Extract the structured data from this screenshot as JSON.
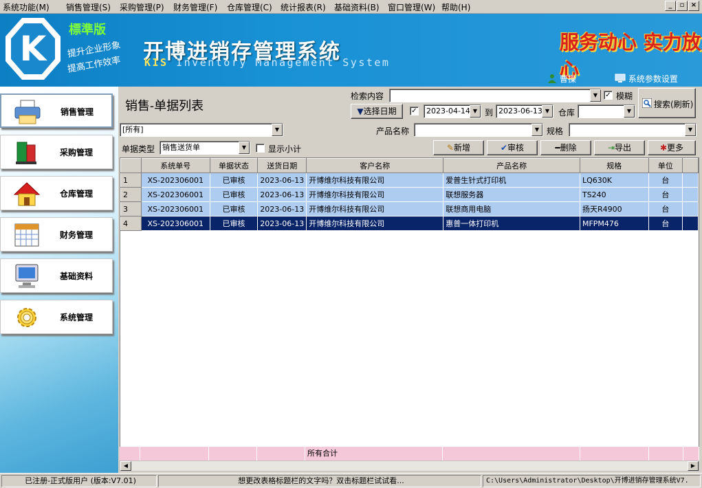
{
  "menu": [
    "系统功能(M)",
    "销售管理(S)",
    "采购管理(P)",
    "财务管理(F)",
    "仓库管理(C)",
    "统计报表(R)",
    "基础资料(B)",
    "窗口管理(W)",
    "帮助(H)"
  ],
  "window_buttons": [
    "_",
    "▫",
    "×"
  ],
  "banner": {
    "logo_letter": "K",
    "edition": "標準版",
    "slogan1": "提升企业形象",
    "slogan2": "提高工作效率",
    "title": "开博进销存管理系统",
    "subtitle_kis": "KIS",
    "subtitle_rest": " Inventory Management System",
    "motto": "服务动心 实力放心",
    "user_name": "曹操",
    "settings_label": "系统参数设置"
  },
  "sidebar": {
    "items": [
      {
        "label": "销售管理",
        "icon": "printer-icon",
        "active": true
      },
      {
        "label": "采购管理",
        "icon": "books-icon"
      },
      {
        "label": "仓库管理",
        "icon": "house-icon"
      },
      {
        "label": "财务管理",
        "icon": "calendar-icon"
      },
      {
        "label": "基础资料",
        "icon": "monitor-icon"
      },
      {
        "label": "系统管理",
        "icon": "gear-icon"
      }
    ]
  },
  "page": {
    "title": "销售-单据列表",
    "search_label": "检索内容",
    "search_value": "",
    "fuzzy_label": "模糊",
    "fuzzy_checked": true,
    "search_button": "搜索(刷新)",
    "date_button": "选择日期",
    "date_checked": true,
    "date_from": "2023-04-14",
    "to_label": "到",
    "date_to": "2023-06-13",
    "warehouse_label": "仓库",
    "warehouse_value": "",
    "filter_all": "[所有]",
    "product_label": "产品名称",
    "product_value": "",
    "spec_label": "规格",
    "spec_value": "",
    "doc_type_label": "单据类型",
    "doc_type_value": "销售送货单",
    "subtotal_label": "显示小计",
    "subtotal_checked": false,
    "actions": {
      "add": "新增",
      "approve": "审核",
      "delete": "删除",
      "export": "导出",
      "more": "更多"
    }
  },
  "table": {
    "columns": [
      "系统单号",
      "单据状态",
      "送货日期",
      "客户名称",
      "产品名称",
      "规格",
      "单位"
    ],
    "rows": [
      {
        "no": "1",
        "id": "XS-202306001",
        "status": "已审核",
        "date": "2023-06-13",
        "customer": "开博维尔科技有限公司",
        "product": "爱普生针式打印机",
        "spec": "LQ630K",
        "unit": "台"
      },
      {
        "no": "2",
        "id": "XS-202306001",
        "status": "已审核",
        "date": "2023-06-13",
        "customer": "开博维尔科技有限公司",
        "product": "联想服务器",
        "spec": "TS240",
        "unit": "台"
      },
      {
        "no": "3",
        "id": "XS-202306001",
        "status": "已审核",
        "date": "2023-06-13",
        "customer": "开博维尔科技有限公司",
        "product": "联想商用电脑",
        "spec": "扬天R4900",
        "unit": "台"
      },
      {
        "no": "4",
        "id": "XS-202306001",
        "status": "已审核",
        "date": "2023-06-13",
        "customer": "开博维尔科技有限公司",
        "product": "惠普一体打印机",
        "spec": "MFPM476",
        "unit": "台"
      }
    ],
    "selected_row": 4,
    "footer_total_label": "所有合计"
  },
  "statusbar": {
    "left": "已注册-正式版用户  (版本:V7.01)",
    "middle": "想更改表格标题栏的文字吗？双击标题栏试试看...",
    "right": "C:\\Users\\Administrator\\Desktop\\开博进销存管理系统V7."
  },
  "colors": {
    "banner": "#1991d5",
    "row_highlight": "#aecbf0",
    "row_selected": "#0a246a",
    "footer": "#f4c8d8",
    "motto": "#d8201c"
  }
}
